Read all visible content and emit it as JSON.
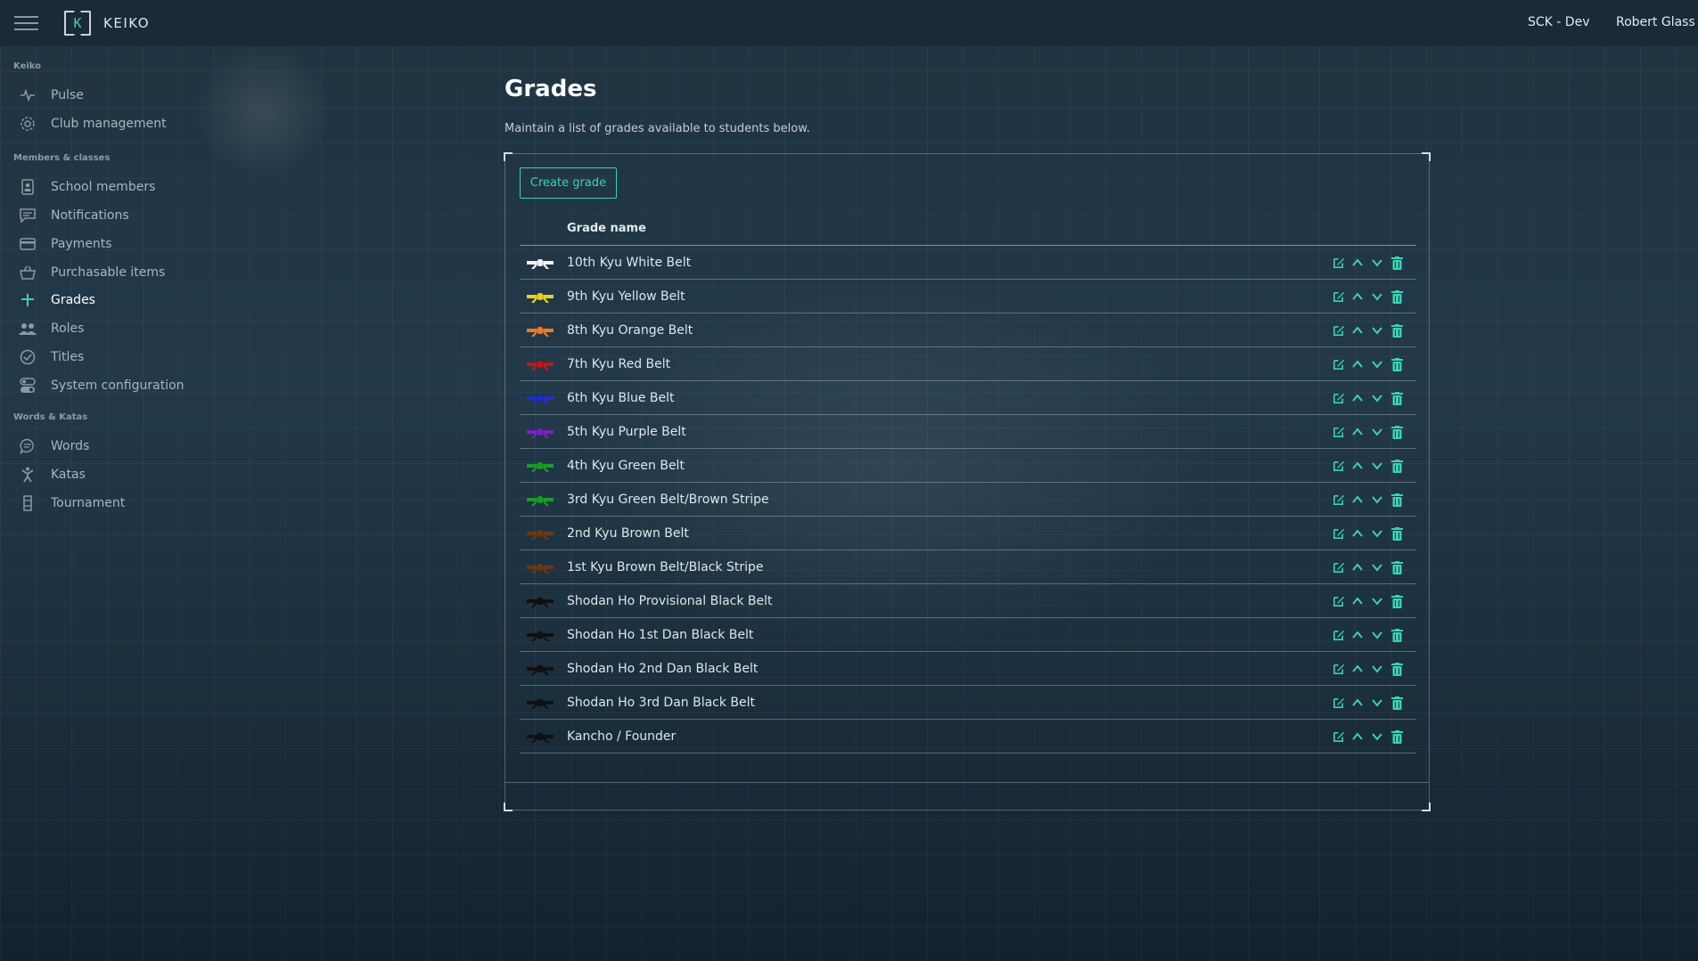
{
  "app": {
    "name": "KEIKO",
    "logo_letter": "K",
    "environment": "SCK - Dev",
    "user": "Robert Glass"
  },
  "sidebar": {
    "sections": [
      {
        "title": "Keiko",
        "items": [
          {
            "label": "Pulse",
            "icon": "pulse-icon"
          },
          {
            "label": "Club management",
            "icon": "gear-icon"
          }
        ]
      },
      {
        "title": "Members & classes",
        "items": [
          {
            "label": "School members",
            "icon": "badge-icon"
          },
          {
            "label": "Notifications",
            "icon": "chat-icon"
          },
          {
            "label": "Payments",
            "icon": "card-icon"
          },
          {
            "label": "Purchasable items",
            "icon": "basket-icon"
          },
          {
            "label": "Grades",
            "icon": "plus-icon",
            "active": true
          },
          {
            "label": "Roles",
            "icon": "users-icon"
          },
          {
            "label": "Titles",
            "icon": "check-circle-icon"
          },
          {
            "label": "System configuration",
            "icon": "toggle-icon"
          }
        ]
      },
      {
        "title": "Words & Katas",
        "items": [
          {
            "label": "Words",
            "icon": "speech-icon"
          },
          {
            "label": "Katas",
            "icon": "figure-icon"
          },
          {
            "label": "Tournament",
            "icon": "bracket-icon"
          }
        ]
      }
    ]
  },
  "main": {
    "title": "Grades",
    "description": "Maintain a list of grades available to students below.",
    "create_button": "Create grade",
    "column_header": "Grade name",
    "grades": [
      {
        "name": "10th Kyu White Belt",
        "color": "#f2f2f2"
      },
      {
        "name": "9th Kyu Yellow Belt",
        "color": "#e8d21c"
      },
      {
        "name": "8th Kyu Orange Belt",
        "color": "#f07a1e"
      },
      {
        "name": "7th Kyu Red Belt",
        "color": "#c01818"
      },
      {
        "name": "6th Kyu Blue Belt",
        "color": "#1e2fc8"
      },
      {
        "name": "5th Kyu Purple Belt",
        "color": "#7a22c4"
      },
      {
        "name": "4th Kyu Green Belt",
        "color": "#1c9a2a"
      },
      {
        "name": "3rd Kyu Green Belt/Brown Stripe",
        "color": "#1c9a2a"
      },
      {
        "name": "2nd Kyu Brown Belt",
        "color": "#6b3a12"
      },
      {
        "name": "1st Kyu Brown Belt/Black Stripe",
        "color": "#6b3a12"
      },
      {
        "name": "Shodan Ho Provisional Black Belt",
        "color": "#111111"
      },
      {
        "name": "Shodan Ho 1st Dan Black Belt",
        "color": "#111111"
      },
      {
        "name": "Shodan Ho 2nd Dan Black Belt",
        "color": "#111111"
      },
      {
        "name": "Shodan Ho 3rd Dan Black Belt",
        "color": "#111111"
      },
      {
        "name": "Kancho / Founder",
        "color": "#111111"
      }
    ]
  },
  "accent_color": "#3fd1b1"
}
